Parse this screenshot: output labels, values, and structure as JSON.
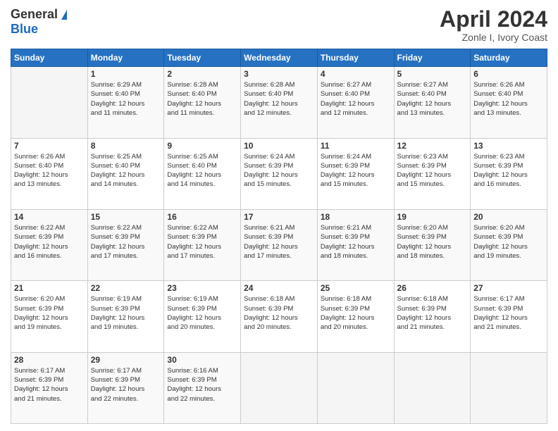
{
  "header": {
    "logo_general": "General",
    "logo_blue": "Blue",
    "month_title": "April 2024",
    "subtitle": "Zonle I, Ivory Coast"
  },
  "days_of_week": [
    "Sunday",
    "Monday",
    "Tuesday",
    "Wednesday",
    "Thursday",
    "Friday",
    "Saturday"
  ],
  "weeks": [
    [
      {
        "day": "",
        "info": ""
      },
      {
        "day": "1",
        "info": "Sunrise: 6:29 AM\nSunset: 6:40 PM\nDaylight: 12 hours\nand 11 minutes."
      },
      {
        "day": "2",
        "info": "Sunrise: 6:28 AM\nSunset: 6:40 PM\nDaylight: 12 hours\nand 11 minutes."
      },
      {
        "day": "3",
        "info": "Sunrise: 6:28 AM\nSunset: 6:40 PM\nDaylight: 12 hours\nand 12 minutes."
      },
      {
        "day": "4",
        "info": "Sunrise: 6:27 AM\nSunset: 6:40 PM\nDaylight: 12 hours\nand 12 minutes."
      },
      {
        "day": "5",
        "info": "Sunrise: 6:27 AM\nSunset: 6:40 PM\nDaylight: 12 hours\nand 13 minutes."
      },
      {
        "day": "6",
        "info": "Sunrise: 6:26 AM\nSunset: 6:40 PM\nDaylight: 12 hours\nand 13 minutes."
      }
    ],
    [
      {
        "day": "7",
        "info": "Sunrise: 6:26 AM\nSunset: 6:40 PM\nDaylight: 12 hours\nand 13 minutes."
      },
      {
        "day": "8",
        "info": "Sunrise: 6:25 AM\nSunset: 6:40 PM\nDaylight: 12 hours\nand 14 minutes."
      },
      {
        "day": "9",
        "info": "Sunrise: 6:25 AM\nSunset: 6:40 PM\nDaylight: 12 hours\nand 14 minutes."
      },
      {
        "day": "10",
        "info": "Sunrise: 6:24 AM\nSunset: 6:39 PM\nDaylight: 12 hours\nand 15 minutes."
      },
      {
        "day": "11",
        "info": "Sunrise: 6:24 AM\nSunset: 6:39 PM\nDaylight: 12 hours\nand 15 minutes."
      },
      {
        "day": "12",
        "info": "Sunrise: 6:23 AM\nSunset: 6:39 PM\nDaylight: 12 hours\nand 15 minutes."
      },
      {
        "day": "13",
        "info": "Sunrise: 6:23 AM\nSunset: 6:39 PM\nDaylight: 12 hours\nand 16 minutes."
      }
    ],
    [
      {
        "day": "14",
        "info": "Sunrise: 6:22 AM\nSunset: 6:39 PM\nDaylight: 12 hours\nand 16 minutes."
      },
      {
        "day": "15",
        "info": "Sunrise: 6:22 AM\nSunset: 6:39 PM\nDaylight: 12 hours\nand 17 minutes."
      },
      {
        "day": "16",
        "info": "Sunrise: 6:22 AM\nSunset: 6:39 PM\nDaylight: 12 hours\nand 17 minutes."
      },
      {
        "day": "17",
        "info": "Sunrise: 6:21 AM\nSunset: 6:39 PM\nDaylight: 12 hours\nand 17 minutes."
      },
      {
        "day": "18",
        "info": "Sunrise: 6:21 AM\nSunset: 6:39 PM\nDaylight: 12 hours\nand 18 minutes."
      },
      {
        "day": "19",
        "info": "Sunrise: 6:20 AM\nSunset: 6:39 PM\nDaylight: 12 hours\nand 18 minutes."
      },
      {
        "day": "20",
        "info": "Sunrise: 6:20 AM\nSunset: 6:39 PM\nDaylight: 12 hours\nand 19 minutes."
      }
    ],
    [
      {
        "day": "21",
        "info": "Sunrise: 6:20 AM\nSunset: 6:39 PM\nDaylight: 12 hours\nand 19 minutes."
      },
      {
        "day": "22",
        "info": "Sunrise: 6:19 AM\nSunset: 6:39 PM\nDaylight: 12 hours\nand 19 minutes."
      },
      {
        "day": "23",
        "info": "Sunrise: 6:19 AM\nSunset: 6:39 PM\nDaylight: 12 hours\nand 20 minutes."
      },
      {
        "day": "24",
        "info": "Sunrise: 6:18 AM\nSunset: 6:39 PM\nDaylight: 12 hours\nand 20 minutes."
      },
      {
        "day": "25",
        "info": "Sunrise: 6:18 AM\nSunset: 6:39 PM\nDaylight: 12 hours\nand 20 minutes."
      },
      {
        "day": "26",
        "info": "Sunrise: 6:18 AM\nSunset: 6:39 PM\nDaylight: 12 hours\nand 21 minutes."
      },
      {
        "day": "27",
        "info": "Sunrise: 6:17 AM\nSunset: 6:39 PM\nDaylight: 12 hours\nand 21 minutes."
      }
    ],
    [
      {
        "day": "28",
        "info": "Sunrise: 6:17 AM\nSunset: 6:39 PM\nDaylight: 12 hours\nand 21 minutes."
      },
      {
        "day": "29",
        "info": "Sunrise: 6:17 AM\nSunset: 6:39 PM\nDaylight: 12 hours\nand 22 minutes."
      },
      {
        "day": "30",
        "info": "Sunrise: 6:16 AM\nSunset: 6:39 PM\nDaylight: 12 hours\nand 22 minutes."
      },
      {
        "day": "",
        "info": ""
      },
      {
        "day": "",
        "info": ""
      },
      {
        "day": "",
        "info": ""
      },
      {
        "day": "",
        "info": ""
      }
    ]
  ]
}
